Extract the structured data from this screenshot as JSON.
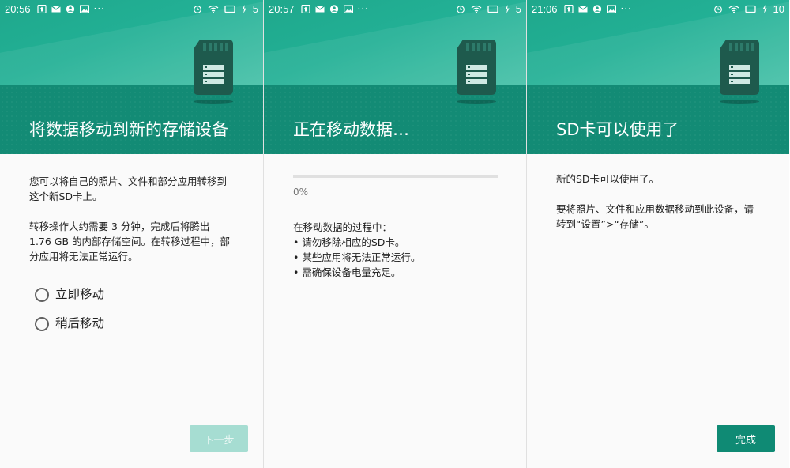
{
  "screens": [
    {
      "status": {
        "time": "20:56",
        "battery": "5"
      },
      "title": "将数据移动到新的存储设备",
      "paragraphs": [
        "您可以将自己的照片、文件和部分应用转移到这个新SD卡上。",
        "转移操作大约需要 3 分钟，完成后将腾出 1.76 GB 的内部存储空间。在转移过程中，部分应用将无法正常运行。"
      ],
      "options": [
        {
          "label": "立即移动"
        },
        {
          "label": "稍后移动"
        }
      ],
      "button": {
        "label": "下一步",
        "enabled": false
      }
    },
    {
      "status": {
        "time": "20:57",
        "battery": "5"
      },
      "title": "正在移动数据…",
      "progress": {
        "percent_label": "0%",
        "value": 0
      },
      "notes": [
        "在移动数据的过程中：",
        "• 请勿移除相应的SD卡。",
        "• 某些应用将无法正常运行。",
        "• 需确保设备电量充足。"
      ]
    },
    {
      "status": {
        "time": "21:06",
        "battery": "10"
      },
      "title": "SD卡可以使用了",
      "paragraphs": [
        "新的SD卡可以使用了。",
        "要将照片、文件和应用数据移动到此设备，请转到“设置”>“存储”。"
      ],
      "button": {
        "label": "完成",
        "enabled": true
      }
    }
  ],
  "colors": {
    "accent": "#0f8a74",
    "hero_light": "#22b095",
    "disabled_button": "#a6ddd2"
  },
  "icons": [
    "upload-icon",
    "mail-icon",
    "account-icon",
    "image-icon",
    "more-icon",
    "alarm-icon",
    "wifi-icon",
    "screen-icon",
    "charging-icon",
    "sd-card-icon"
  ]
}
